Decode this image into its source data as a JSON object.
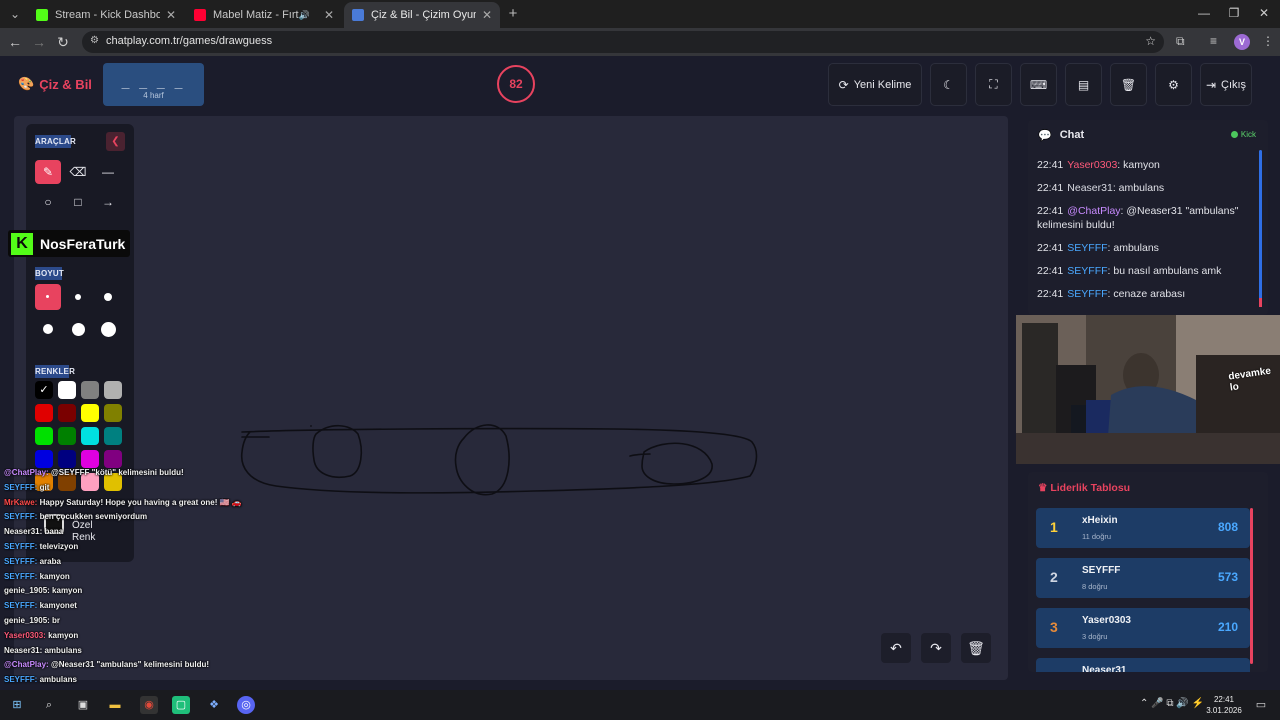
{
  "browser": {
    "tabs": [
      {
        "title": "Stream - Kick Dashboard",
        "color": "#53fc18",
        "icon": "kick-icon"
      },
      {
        "title": "Mabel Matiz - Fırtınadayım",
        "color": "#ff0033",
        "icon": "youtube-icon"
      },
      {
        "title": "Çiz & Bil - Çizim Oyunu",
        "color": "#4a7bd8",
        "icon": "chatplay-icon"
      }
    ],
    "url": "chatplay.com.tr/games/drawguess"
  },
  "app": {
    "logo": "Çiz & Bil",
    "word": {
      "mask": "_ _ _ _",
      "length_label": "4 harf"
    },
    "timer": "82",
    "buttons": {
      "new_word": "Yeni Kelime",
      "logout": "Çıkış"
    },
    "accent": "#e8435f"
  },
  "tools": {
    "tools_label": "ARAÇLAR",
    "size_label": "BOYUT",
    "colors_label": "RENKLER",
    "custom_label_1": "Özel",
    "custom_label_2": "Renk",
    "palette": [
      "#000000",
      "#ffffff",
      "#808080",
      "#b0b0b0",
      "#e00000",
      "#7a0000",
      "#ffff00",
      "#808000",
      "#00e000",
      "#008000",
      "#00e0e0",
      "#008080",
      "#0000e0",
      "#000080",
      "#e000e0",
      "#800080",
      "#e08000",
      "#804000",
      "#ffa0c0",
      "#e0c000"
    ]
  },
  "overlay": {
    "streamer": "NosFeraTurk",
    "chat": [
      {
        "user": "@ChatPlay:",
        "msg": "@SEYFFF \"kötü\" kelimesini buldu!",
        "color": "#c88bff"
      },
      {
        "user": "SEYFFF:",
        "msg": "git",
        "color": "#4aa8ff"
      },
      {
        "user": "MrKawe:",
        "msg": "Happy Saturday! Hope you having a great one! 🇺🇸 🚗",
        "color": "#ff4a4a"
      },
      {
        "user": "SEYFFF:",
        "msg": "ben çocukken sevmiyordum",
        "color": "#4aa8ff"
      },
      {
        "user": "Neaser31:",
        "msg": "bana",
        "color": "#f0f0f0"
      },
      {
        "user": "SEYFFF:",
        "msg": "televizyon",
        "color": "#4aa8ff"
      },
      {
        "user": "SEYFFF:",
        "msg": "araba",
        "color": "#4aa8ff"
      },
      {
        "user": "SEYFFF:",
        "msg": "kamyon",
        "color": "#4aa8ff"
      },
      {
        "user": "genie_1905:",
        "msg": "kamyon",
        "color": "#f0f0f0"
      },
      {
        "user": "SEYFFF:",
        "msg": "kamyonet",
        "color": "#4aa8ff"
      },
      {
        "user": "genie_1905:",
        "msg": "br",
        "color": "#f0f0f0"
      },
      {
        "user": "Yaser0303:",
        "msg": "kamyon",
        "color": "#ff5a7a"
      },
      {
        "user": "Neaser31:",
        "msg": "ambulans",
        "color": "#f0f0f0"
      },
      {
        "user": "@ChatPlay:",
        "msg": "@Neaser31 \"ambulans\" kelimesini buldu!",
        "color": "#c88bff"
      },
      {
        "user": "SEYFFF:",
        "msg": "ambulans",
        "color": "#4aa8ff"
      },
      {
        "user": "SEYFFF:",
        "msg": "bu nasıl ambulans amk",
        "color": "#4aa8ff"
      },
      {
        "user": "SEYFFF:",
        "msg": "cenaze arabası",
        "color": "#4aa8ff"
      }
    ]
  },
  "chat": {
    "title": "Chat",
    "status": "Kick",
    "messages": [
      {
        "time": "22:41",
        "user": "Yaser0303",
        "text": ": kamyon",
        "color": "#ff5a7a"
      },
      {
        "time": "22:41",
        "user": "Neaser31",
        "text": ": ambulans",
        "color": "#d8dae2"
      },
      {
        "time": "22:41",
        "user": "@ChatPlay",
        "text": ": @Neaser31 \"ambulans\" kelimesini buldu!",
        "color": "#c88bff"
      },
      {
        "time": "22:41",
        "user": "SEYFFF",
        "text": ": ambulans",
        "color": "#4aa8ff"
      },
      {
        "time": "22:41",
        "user": "SEYFFF",
        "text": ": bu nasıl ambulans amk",
        "color": "#4aa8ff"
      },
      {
        "time": "22:41",
        "user": "SEYFFF",
        "text": ": cenaze arabası",
        "color": "#4aa8ff"
      }
    ]
  },
  "webcam_text": "devamke lo",
  "leaderboard": {
    "title": "Liderlik Tablosu",
    "rows": [
      {
        "rank": "1",
        "name": "xHeixin",
        "sub": "11 doğru",
        "points": "808",
        "rank_color": "#ffd23a"
      },
      {
        "rank": "2",
        "name": "SEYFFF",
        "sub": "8 doğru",
        "points": "573",
        "rank_color": "#cfd6e2"
      },
      {
        "rank": "3",
        "name": "Yaser0303",
        "sub": "3 doğru",
        "points": "210",
        "rank_color": "#e58a3a"
      },
      {
        "rank": "",
        "name": "Neaser31",
        "sub": "",
        "points": "",
        "rank_color": "#cfd6e2"
      }
    ]
  },
  "taskbar": {
    "time": "22:41",
    "date": "3.01.2026"
  }
}
